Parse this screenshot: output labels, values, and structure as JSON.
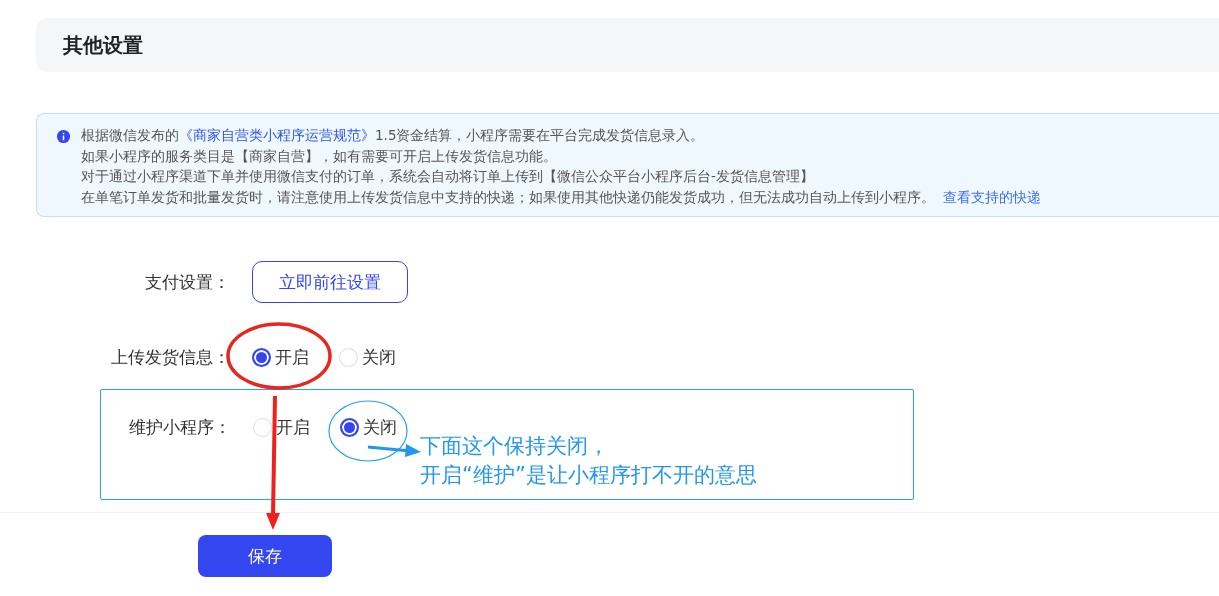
{
  "section_title": "其他设置",
  "notice": {
    "lines": [
      [
        {
          "kind": "text",
          "text": "根据微信发布的"
        },
        {
          "kind": "link",
          "text": "《商家自营类小程序运营规范》"
        },
        {
          "kind": "text",
          "text": "1.5资金结算，小程序需要在平台完成发货信息录入。"
        }
      ],
      [
        {
          "kind": "text",
          "text": "如果小程序的服务类目是【商家自营】，如有需要可开启上传发货信息功能。"
        }
      ],
      [
        {
          "kind": "text",
          "text": "对于通过小程序渠道下单并使用微信支付的订单，系统会自动将订单上传到【微信公众平台小程序后台-发货信息管理】"
        }
      ],
      [
        {
          "kind": "text",
          "text": "在单笔订单发货和批量发货时，请注意使用上传发货信息中支持的快递；如果使用其他快递仍能发货成功，但无法成功自动上传到小程序。"
        },
        {
          "kind": "link",
          "text": "查看支持的快递"
        }
      ]
    ]
  },
  "form": {
    "rows": [
      {
        "kind": "button",
        "label": "支付设置：",
        "button": "立即前往设置"
      },
      {
        "kind": "radio",
        "label": "上传发货信息：",
        "options": [
          {
            "label": "开启",
            "selected": true
          },
          {
            "label": "关闭",
            "selected": false
          }
        ]
      },
      {
        "kind": "radio",
        "label": "维护小程序：",
        "options": [
          {
            "label": "开启",
            "selected": false
          },
          {
            "label": "关闭",
            "selected": true
          }
        ]
      }
    ]
  },
  "annotation_note": [
    "下面这个保持关闭，",
    "开启“维护”是让小程序打不开的意思"
  ],
  "save_button": "保存"
}
